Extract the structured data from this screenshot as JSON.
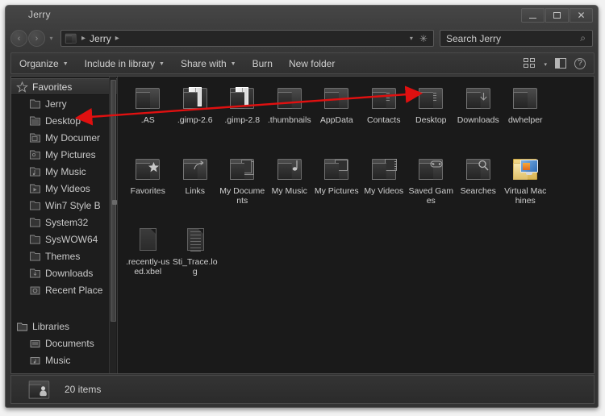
{
  "window": {
    "title": "Jerry",
    "controls": {
      "minimize": "—",
      "maximize": "☐",
      "close": "✕"
    }
  },
  "address_bar": {
    "back_icon": "‹",
    "forward_icon": "›",
    "history_caret": "▾",
    "crumbs": [
      "Jerry"
    ],
    "separator": "▸",
    "dropdown_caret": "▾",
    "refresh_icon": "✳"
  },
  "search": {
    "placeholder": "Search Jerry",
    "icon": "⌕"
  },
  "toolbar": {
    "items": [
      {
        "label": "Organize",
        "has_caret": true
      },
      {
        "label": "Include in library",
        "has_caret": true
      },
      {
        "label": "Share with",
        "has_caret": true
      },
      {
        "label": "Burn",
        "has_caret": false
      },
      {
        "label": "New folder",
        "has_caret": false
      }
    ],
    "view_caret": "▾",
    "help_glyph": "?"
  },
  "sidebar": {
    "groups": [
      {
        "header": {
          "label": "Favorites",
          "icon": "star-icon",
          "selected": true
        },
        "items": [
          {
            "label": "Jerry",
            "icon": "folder-icon"
          },
          {
            "label": "Desktop",
            "icon": "desktop-folder-icon"
          },
          {
            "label": "My Documer",
            "icon": "documents-folder-icon"
          },
          {
            "label": "My Pictures",
            "icon": "pictures-folder-icon"
          },
          {
            "label": "My Music",
            "icon": "music-folder-icon"
          },
          {
            "label": "My Videos",
            "icon": "videos-folder-icon"
          },
          {
            "label": "Win7 Style B",
            "icon": "folder-icon"
          },
          {
            "label": "System32",
            "icon": "folder-icon"
          },
          {
            "label": "SysWOW64",
            "icon": "folder-icon"
          },
          {
            "label": "Themes",
            "icon": "folder-icon"
          },
          {
            "label": "Downloads",
            "icon": "downloads-folder-icon"
          },
          {
            "label": "Recent Place",
            "icon": "recent-places-icon"
          }
        ]
      },
      {
        "header": {
          "label": "Libraries",
          "icon": "libraries-icon",
          "selected": false
        },
        "items": [
          {
            "label": "Documents",
            "icon": "documents-library-icon"
          },
          {
            "label": "Music",
            "icon": "music-library-icon"
          }
        ]
      }
    ]
  },
  "files": [
    {
      "label": ".AS",
      "icon": "folder"
    },
    {
      "label": ".gimp-2.6",
      "icon": "folder-white-page"
    },
    {
      "label": ".gimp-2.8",
      "icon": "folder-white-page"
    },
    {
      "label": ".thumbnails",
      "icon": "folder"
    },
    {
      "label": "AppData",
      "icon": "folder"
    },
    {
      "label": "Contacts",
      "icon": "folder-contacts"
    },
    {
      "label": "Desktop",
      "icon": "folder-desktop"
    },
    {
      "label": "Downloads",
      "icon": "folder-downloads"
    },
    {
      "label": "dwhelper",
      "icon": "folder"
    },
    {
      "label": "Favorites",
      "icon": "folder-favorites"
    },
    {
      "label": "Links",
      "icon": "folder-links"
    },
    {
      "label": "My Documents",
      "icon": "folder-documents"
    },
    {
      "label": "My Music",
      "icon": "folder-music"
    },
    {
      "label": "My Pictures",
      "icon": "folder-pictures"
    },
    {
      "label": "My Videos",
      "icon": "folder-videos"
    },
    {
      "label": "Saved Games",
      "icon": "folder-games"
    },
    {
      "label": "Searches",
      "icon": "folder-search"
    },
    {
      "label": "Virtual Machines",
      "icon": "folder-virtual-machines"
    },
    {
      "label": ".recently-used.xbel",
      "icon": "file"
    },
    {
      "label": "Sti_Trace.log",
      "icon": "file-log"
    }
  ],
  "status_bar": {
    "text": "20 items",
    "icon": "user-folder-icon"
  },
  "annotation": {
    "color": "#e01010",
    "type": "double-headed-arrow",
    "from": "sidebar-item-desktop",
    "to": "file-tile-desktop"
  },
  "colors": {
    "window_background": "#333333",
    "content_background": "#1a1a1a",
    "sidebar_background": "#1d1d1d",
    "text": "#cfcfcf",
    "annotation_red": "#e01010"
  }
}
